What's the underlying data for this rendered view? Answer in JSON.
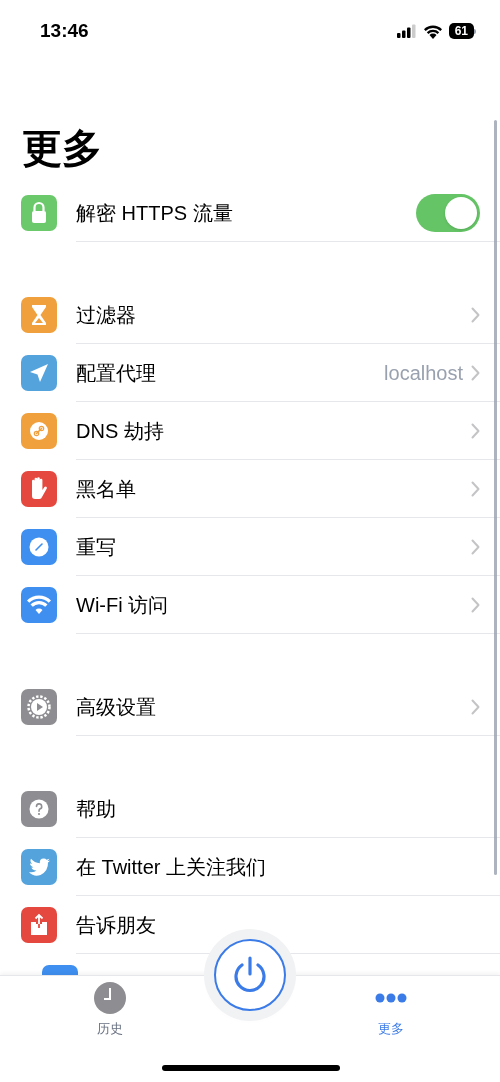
{
  "status_bar": {
    "time": "13:46",
    "battery": "61"
  },
  "title": "更多",
  "sections": [
    {
      "rows": [
        {
          "kind": "toggle",
          "label": "解密 HTTPS 流量",
          "color": "#6cc96b",
          "on": true
        }
      ]
    },
    {
      "rows": [
        {
          "kind": "link",
          "label": "过滤器",
          "color": "#f0a03c"
        },
        {
          "kind": "link",
          "label": "配置代理",
          "color": "#55a3dc",
          "value": "localhost"
        },
        {
          "kind": "link",
          "label": "DNS 劫持",
          "color": "#f0a03c"
        },
        {
          "kind": "link",
          "label": "黑名单",
          "color": "#e5483f"
        },
        {
          "kind": "link",
          "label": "重写",
          "color": "#3f8ff0"
        },
        {
          "kind": "link",
          "label": "Wi-Fi 访问",
          "color": "#3f8ff0"
        }
      ]
    },
    {
      "rows": [
        {
          "kind": "link",
          "label": "高级设置",
          "color": "#8e8e92"
        }
      ]
    },
    {
      "rows": [
        {
          "kind": "action",
          "label": "帮助",
          "color": "#8e8e92"
        },
        {
          "kind": "action",
          "label": "在 Twitter 上关注我们",
          "color": "#55a3dc"
        },
        {
          "kind": "action",
          "label": "告诉朋友",
          "color": "#e5483f"
        },
        {
          "kind": "clipped",
          "color": "#3f8ff0"
        }
      ]
    }
  ],
  "tab_bar": {
    "tabs": [
      {
        "label": "历史",
        "selected": false
      },
      {
        "label": "更多",
        "selected": true
      }
    ]
  }
}
